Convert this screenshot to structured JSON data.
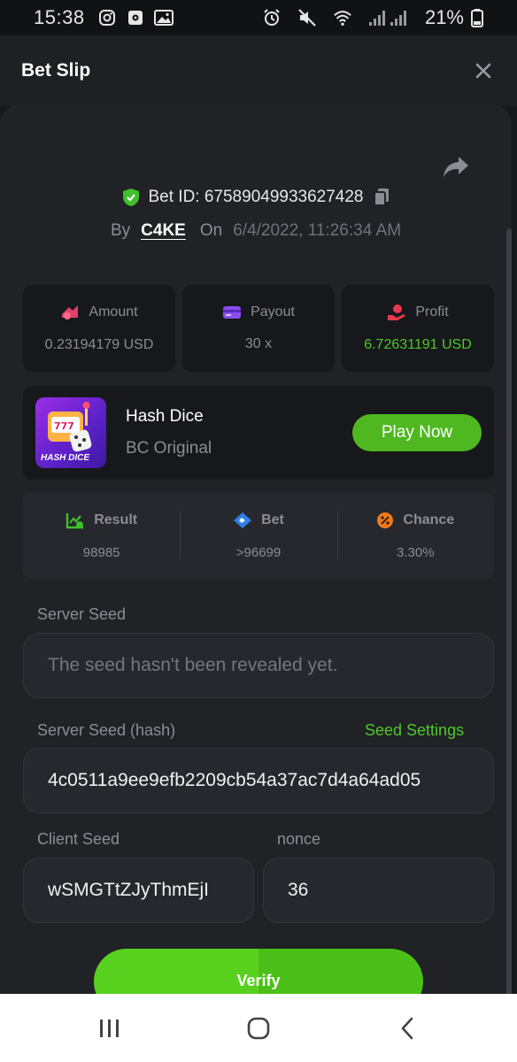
{
  "status_bar": {
    "time": "15:38",
    "battery": "21%",
    "icons": [
      "instagram-icon",
      "sim-icon",
      "gallery-icon",
      "alarm-icon",
      "mute-icon",
      "wifi-icon",
      "signal-icon",
      "battery-icon"
    ]
  },
  "header": {
    "title": "Bet Slip",
    "close_icon": "close-icon"
  },
  "bet": {
    "id_label": "Bet ID: 67589049933627428",
    "by_label": "By",
    "user": "C4KE",
    "on_label": "On",
    "date": "6/4/2022, 11:26:34 AM"
  },
  "stats": [
    {
      "label": "Amount",
      "value": "0.23194179 USD",
      "icon": "amount-icon"
    },
    {
      "label": "Payout",
      "value": "30 x",
      "icon": "payout-icon"
    },
    {
      "label": "Profit",
      "value": "6.72631191 USD",
      "icon": "profit-icon"
    }
  ],
  "game": {
    "thumb_label": "HASH DICE",
    "name": "Hash Dice",
    "provider": "BC Original",
    "play_label": "Play Now"
  },
  "result": [
    {
      "label": "Result",
      "value": "98985",
      "icon": "result-icon"
    },
    {
      "label": "Bet",
      "value": ">96699",
      "icon": "bet-icon"
    },
    {
      "label": "Chance",
      "value": "3.30%",
      "icon": "chance-icon"
    }
  ],
  "seeds": {
    "server_seed_label": "Server Seed",
    "server_seed_placeholder": "The seed hasn't been revealed yet.",
    "server_hash_label": "Server Seed (hash)",
    "seed_settings_label": "Seed Settings",
    "server_hash_value": "4c0511a9ee9efb2209cb54a37ac7d4a64ad05",
    "client_seed_label": "Client Seed",
    "client_seed_value": "wSMGTtZJyThmEjI",
    "nonce_label": "nonce",
    "nonce_value": "36"
  },
  "verify_label": "Verify",
  "colors": {
    "accent_green": "#4fb821",
    "profit_green": "#4fc72a",
    "background": "#17181b",
    "panel": "#202226"
  }
}
